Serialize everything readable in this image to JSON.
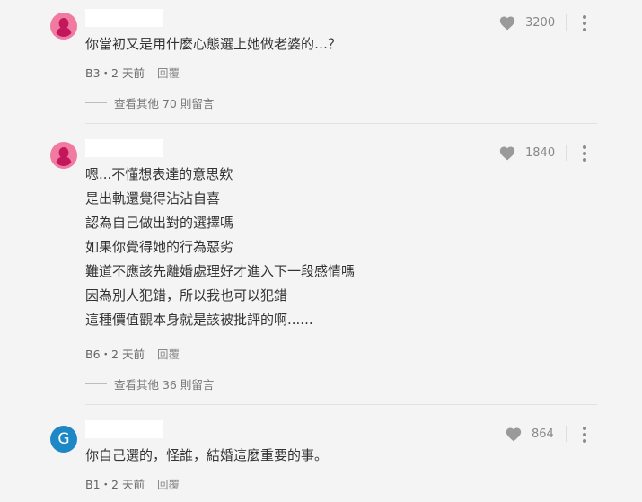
{
  "comments": [
    {
      "avatar_type": "pink-silhouette",
      "likes": "3200",
      "lines": [
        "你當初又是用什麼心態選上她做老婆的…？"
      ],
      "floor": "B3",
      "time": "2 天前",
      "reply_label": "回覆",
      "more_replies": "查看其他 70 則留言"
    },
    {
      "avatar_type": "pink-silhouette",
      "likes": "1840",
      "lines": [
        "嗯...不懂想表達的意思欸",
        "是出軌還覺得沾沾自喜",
        "認為自己做出對的選擇嗎",
        "如果你覺得她的行為惡劣",
        "難道不應該先離婚處理好才進入下一段感情嗎",
        "因為別人犯錯，所以我也可以犯錯",
        "這種價值觀本身就是該被批評的啊......"
      ],
      "floor": "B6",
      "time": "2 天前",
      "reply_label": "回覆",
      "more_replies": "查看其他 36 則留言"
    },
    {
      "avatar_type": "letter",
      "avatar_letter": "G",
      "likes": "864",
      "lines": [
        "你自己選的，怪誰，結婚這麼重要的事。"
      ],
      "floor": "B1",
      "time": "2 天前",
      "reply_label": "回覆"
    }
  ],
  "meta_separator": "・",
  "icons": {
    "like": "heart-icon",
    "menu": "more-vert-icon",
    "avatar": "user-silhouette-icon"
  },
  "colors": {
    "avatar_pink": "#f07aa0",
    "avatar_blue": "#1e88c7",
    "heart": "#9a9a9a"
  }
}
